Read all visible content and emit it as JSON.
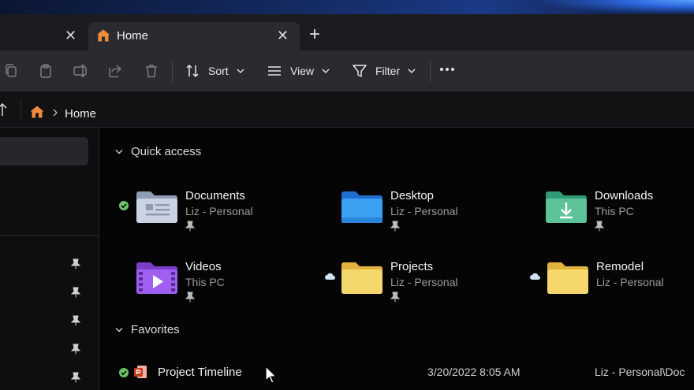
{
  "tabs": {
    "active_title": "Home",
    "close_glyph": "✕",
    "new_tab_glyph": "+"
  },
  "toolbar": {
    "sort_label": "Sort",
    "view_label": "View",
    "filter_label": "Filter",
    "icons": [
      "copy-icon",
      "paste-icon",
      "rename-icon",
      "share-icon",
      "delete-icon",
      "sort-icon",
      "view-icon",
      "filter-icon",
      "more-icon"
    ]
  },
  "address": {
    "path": "Home"
  },
  "quick_access": {
    "header": "Quick access",
    "items": [
      {
        "name": "Documents",
        "sub": "Liz - Personal",
        "icon": "documents-folder-icon",
        "status": "synced"
      },
      {
        "name": "Desktop",
        "sub": "Liz - Personal",
        "icon": "desktop-folder-icon",
        "status": ""
      },
      {
        "name": "Downloads",
        "sub": "This PC",
        "icon": "downloads-folder-icon",
        "status": ""
      },
      {
        "name": "Videos",
        "sub": "This PC",
        "icon": "videos-folder-icon",
        "status": ""
      },
      {
        "name": "Projects",
        "sub": "Liz - Personal",
        "icon": "folder-icon",
        "status": "cloud"
      },
      {
        "name": "Remodel",
        "sub": "Liz - Personal",
        "icon": "folder-icon",
        "status": "cloud"
      }
    ]
  },
  "favorites": {
    "header": "Favorites",
    "items": [
      {
        "name": "Project Timeline",
        "date": "3/20/2022 8:05 AM",
        "location": "Liz - Personal\\Doc",
        "icon": "powerpoint-file-icon",
        "status": "synced"
      }
    ]
  },
  "colors": {
    "accent_green": "#6cc36a",
    "folder_yellow": "#f5d76b",
    "home_orange": "#f28c3b"
  }
}
